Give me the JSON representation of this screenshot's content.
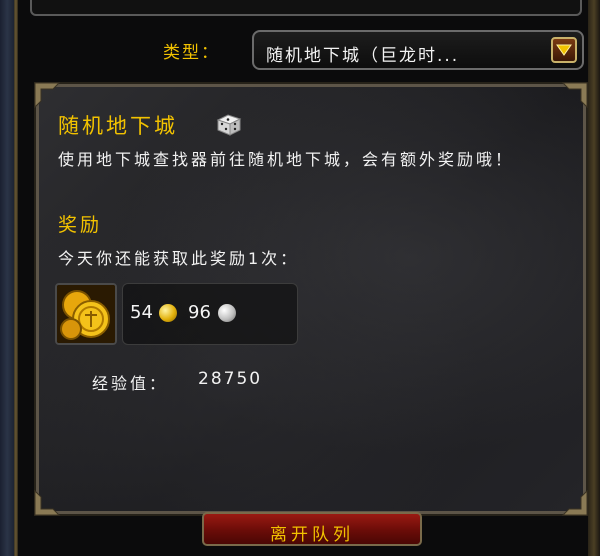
{
  "type_selector": {
    "label": "类型：",
    "value": "随机地下城（巨龙时..."
  },
  "dungeon": {
    "title": "随机地下城",
    "description": "使用地下城查找器前往随机地下城，会有额外奖励哦！"
  },
  "rewards": {
    "title": "奖励",
    "limit_text": "今天你还能获取此奖励1次：",
    "gold": "54",
    "silver": "96",
    "xp_label": "经验值：",
    "xp_value": "28750"
  },
  "leave_button": {
    "label": "离开队列"
  },
  "colors": {
    "gold_text": "#f2c200",
    "body_text": "#f2f2f2",
    "button_red": "#8a140e"
  },
  "icons": [
    "dropdown-arrow-icon",
    "dice-icon",
    "gold-coins-icon",
    "gold-coin-icon",
    "silver-coin-icon"
  ]
}
